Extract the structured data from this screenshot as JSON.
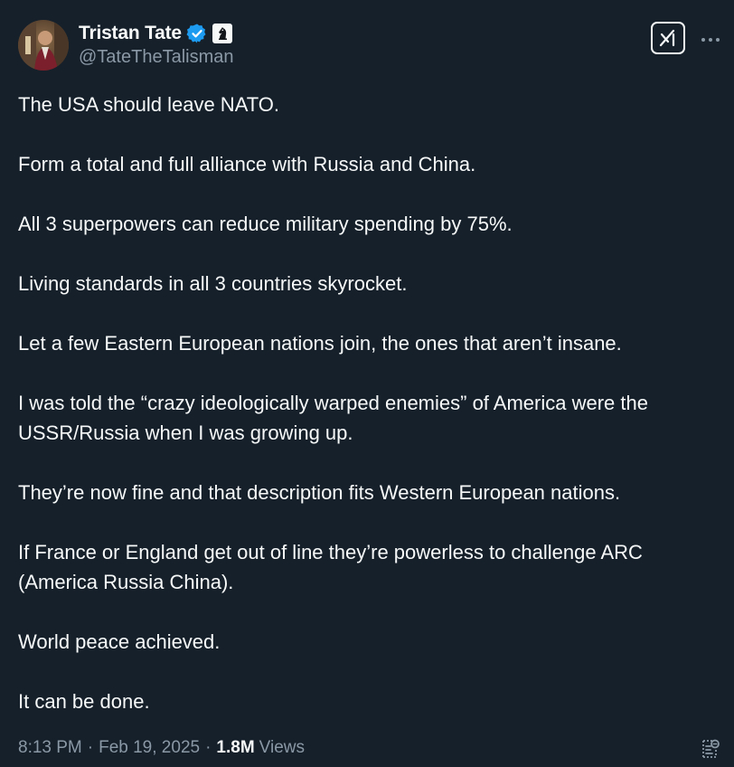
{
  "author": {
    "display_name": "Tristan Tate",
    "handle": "@TateTheTalisman",
    "verified": true,
    "verified_color": "#1d9bf0",
    "affiliate_badge_icon": "chess-knight-icon"
  },
  "tweet": {
    "paragraphs": [
      "The USA should leave NATO.",
      "Form a total and full alliance with Russia and China.",
      "All 3 superpowers can reduce military spending by 75%.",
      "Living standards in all 3 countries skyrocket.",
      "Let a few Eastern European nations join, the ones that aren’t insane.",
      "I was told the “crazy ideologically warped enemies” of America were the USSR/Russia when I was growing up.",
      "They’re now fine and that description fits Western European nations.",
      "If France or England get out of line they’re powerless to challenge ARC (America Russia China).",
      "World peace achieved.",
      "It can be done."
    ],
    "time": "8:13 PM",
    "separator": "·",
    "date": "Feb 19, 2025",
    "views_count": "1.8M",
    "views_label": "Views"
  },
  "actions": {
    "grok_icon": "grok-icon",
    "more_icon": "more-options-icon",
    "bookmark_icon": "bookmark-summary-icon"
  },
  "theme": {
    "background": "#15202b",
    "text": "#f7f9f9",
    "muted": "#8b98a5"
  }
}
